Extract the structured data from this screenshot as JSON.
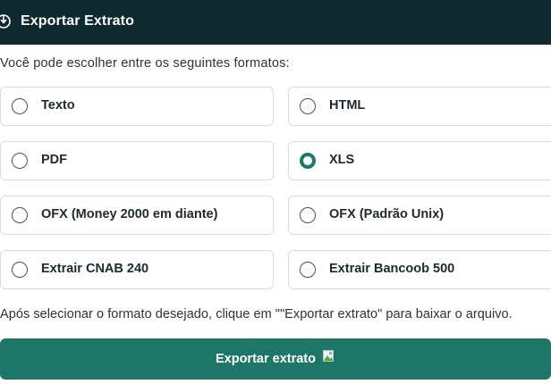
{
  "header": {
    "title": "Exportar Extrato",
    "icon": "download-circle-icon"
  },
  "intro_text": "Você pode escolher entre os seguintes formatos:",
  "formats": [
    {
      "label": "Texto",
      "selected": false
    },
    {
      "label": "HTML",
      "selected": false
    },
    {
      "label": "PDF",
      "selected": false
    },
    {
      "label": "XLS",
      "selected": true
    },
    {
      "label": "OFX (Money 2000 em diante)",
      "selected": false
    },
    {
      "label": "OFX (Padrão Unix)",
      "selected": false
    },
    {
      "label": "Extrair CNAB 240",
      "selected": false
    },
    {
      "label": "Extrair Bancoob 500",
      "selected": false
    }
  ],
  "note_text": "Após selecionar o formato desejado, clique em \"\"Exportar extrato\" para baixar o arquivo.",
  "export_button": {
    "label": "Exportar extrato",
    "icon": "broken-image-icon"
  },
  "colors": {
    "header_bg": "#0f2a2e",
    "accent": "#1e7669",
    "radio_checked": "#1f7a6d"
  }
}
